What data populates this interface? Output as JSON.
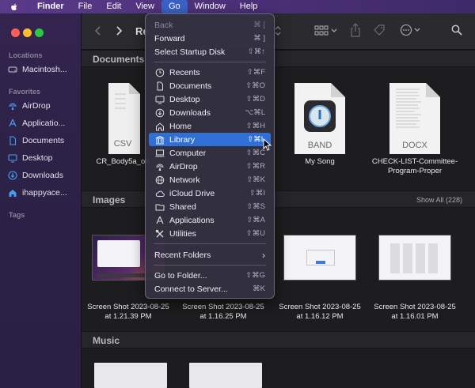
{
  "menubar": {
    "items": [
      "Finder",
      "File",
      "Edit",
      "View",
      "Go",
      "Window",
      "Help"
    ],
    "active": "Go"
  },
  "toolbar": {
    "title_partial": "Re"
  },
  "sidebar": {
    "locations_header": "Locations",
    "locations": [
      {
        "label": "Macintosh...",
        "icon": "hard-drive-icon"
      }
    ],
    "favorites_header": "Favorites",
    "favorites": [
      {
        "label": "AirDrop",
        "icon": "airdrop-icon"
      },
      {
        "label": "Applicatio...",
        "icon": "applications-icon"
      },
      {
        "label": "Documents",
        "icon": "document-icon"
      },
      {
        "label": "Desktop",
        "icon": "desktop-icon"
      },
      {
        "label": "Downloads",
        "icon": "downloads-icon"
      },
      {
        "label": "ihappyace...",
        "icon": "home-icon"
      }
    ],
    "tags_header": "Tags"
  },
  "sections": {
    "documents": {
      "title": "Documents",
      "files": [
        {
          "name": "CR_Body5a_on",
          "badge": "CSV"
        },
        {
          "name": "My Song",
          "badge": "BAND"
        },
        {
          "name": "CHECK-LIST-Committee-Program-Proper",
          "badge": "DOCX"
        }
      ]
    },
    "images": {
      "title": "Images",
      "show_all": "Show All (228)",
      "files": [
        {
          "line1": "Screen Shot 2023-08-25",
          "line2": "at 1.21.39 PM"
        },
        {
          "line1": "Screen Shot 2023-08-25",
          "line2": "at 1.16.25 PM"
        },
        {
          "line1": "Screen Shot 2023-08-25",
          "line2": "at 1.16.12 PM"
        },
        {
          "line1": "Screen Shot 2023-08-25",
          "line2": "at 1.16.01 PM"
        }
      ]
    },
    "music": {
      "title": "Music"
    }
  },
  "go_menu": {
    "items": [
      {
        "label": "Back",
        "shortcut": "⌘ [",
        "disabled": true
      },
      {
        "label": "Forward",
        "shortcut": "⌘ ]"
      },
      {
        "label": "Select Startup Disk",
        "shortcut": "⇧⌘↑"
      },
      {
        "label": "Recents",
        "shortcut": "⇧⌘F",
        "icon": "clock-icon"
      },
      {
        "label": "Documents",
        "shortcut": "⇧⌘O",
        "icon": "document-icon"
      },
      {
        "label": "Desktop",
        "shortcut": "⇧⌘D",
        "icon": "desktop-icon"
      },
      {
        "label": "Downloads",
        "shortcut": "⌥⌘L",
        "icon": "downloads-icon"
      },
      {
        "label": "Home",
        "shortcut": "⇧⌘H",
        "icon": "home-icon"
      },
      {
        "label": "Library",
        "shortcut": "⇧⌘L",
        "icon": "library-icon",
        "highlighted": true
      },
      {
        "label": "Computer",
        "shortcut": "⇧⌘C",
        "icon": "computer-icon"
      },
      {
        "label": "AirDrop",
        "shortcut": "⇧⌘R",
        "icon": "airdrop-icon"
      },
      {
        "label": "Network",
        "shortcut": "⇧⌘K",
        "icon": "globe-icon"
      },
      {
        "label": "iCloud Drive",
        "shortcut": "⇧⌘I",
        "icon": "cloud-icon"
      },
      {
        "label": "Shared",
        "shortcut": "⇧⌘S",
        "icon": "shared-folder-icon"
      },
      {
        "label": "Applications",
        "shortcut": "⇧⌘A",
        "icon": "applications-icon"
      },
      {
        "label": "Utilities",
        "shortcut": "⇧⌘U",
        "icon": "utilities-icon"
      },
      {
        "label": "Recent Folders",
        "shortcut": "›"
      },
      {
        "label": "Go to Folder...",
        "shortcut": "⇧⌘G"
      },
      {
        "label": "Connect to Server...",
        "shortcut": "⌘K"
      }
    ]
  }
}
